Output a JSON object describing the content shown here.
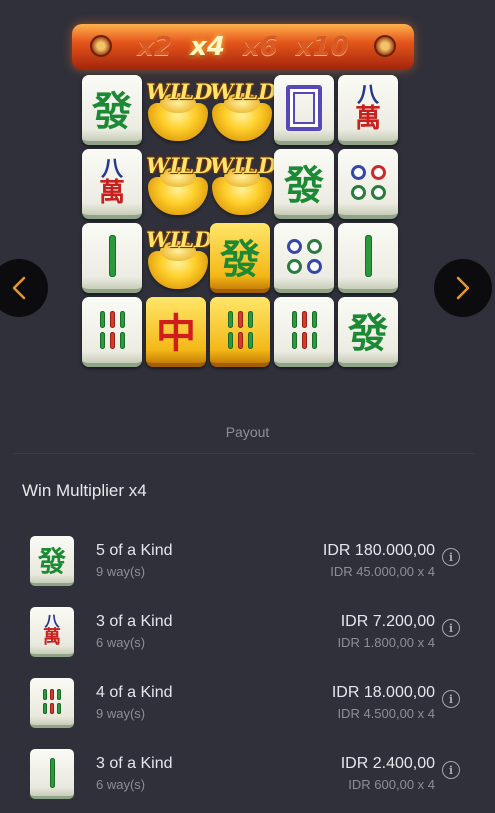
{
  "multiplier_bar": {
    "values": [
      "x2",
      "x4",
      "x6",
      "x10"
    ],
    "active": "x4"
  },
  "grid": {
    "wild_label": "WILD",
    "symbols": {
      "fa": "發",
      "zhong": "中",
      "wan_number": "八",
      "wan_char": "萬"
    }
  },
  "nav": {
    "prev_icon": "chevron-left-icon",
    "next_icon": "chevron-right-icon",
    "accent": "#e8962a"
  },
  "payout": {
    "title": "Payout",
    "win_multiplier": "Win Multiplier x4",
    "rows": [
      {
        "symbol": "fa-tile-icon",
        "kind": "5 of a Kind",
        "ways": "9 way(s)",
        "amount": "IDR 180.000,00",
        "calc": "IDR 45.000,00 x 4"
      },
      {
        "symbol": "eight-wan-tile-icon",
        "kind": "3 of a Kind",
        "ways": "6 way(s)",
        "amount": "IDR 7.200,00",
        "calc": "IDR 1.800,00 x 4"
      },
      {
        "symbol": "six-bamboo-tile-icon",
        "kind": "4 of a Kind",
        "ways": "9 way(s)",
        "amount": "IDR 18.000,00",
        "calc": "IDR 4.500,00 x 4"
      },
      {
        "symbol": "two-bamboo-tile-icon",
        "kind": "3 of a Kind",
        "ways": "6 way(s)",
        "amount": "IDR 2.400,00",
        "calc": "IDR 600,00 x 4"
      }
    ],
    "info_glyph": "i"
  },
  "colors": {
    "background": "#30303a",
    "muted_text": "#8e8e99",
    "gold": "#f4b817",
    "jade": "#1c8a35"
  }
}
